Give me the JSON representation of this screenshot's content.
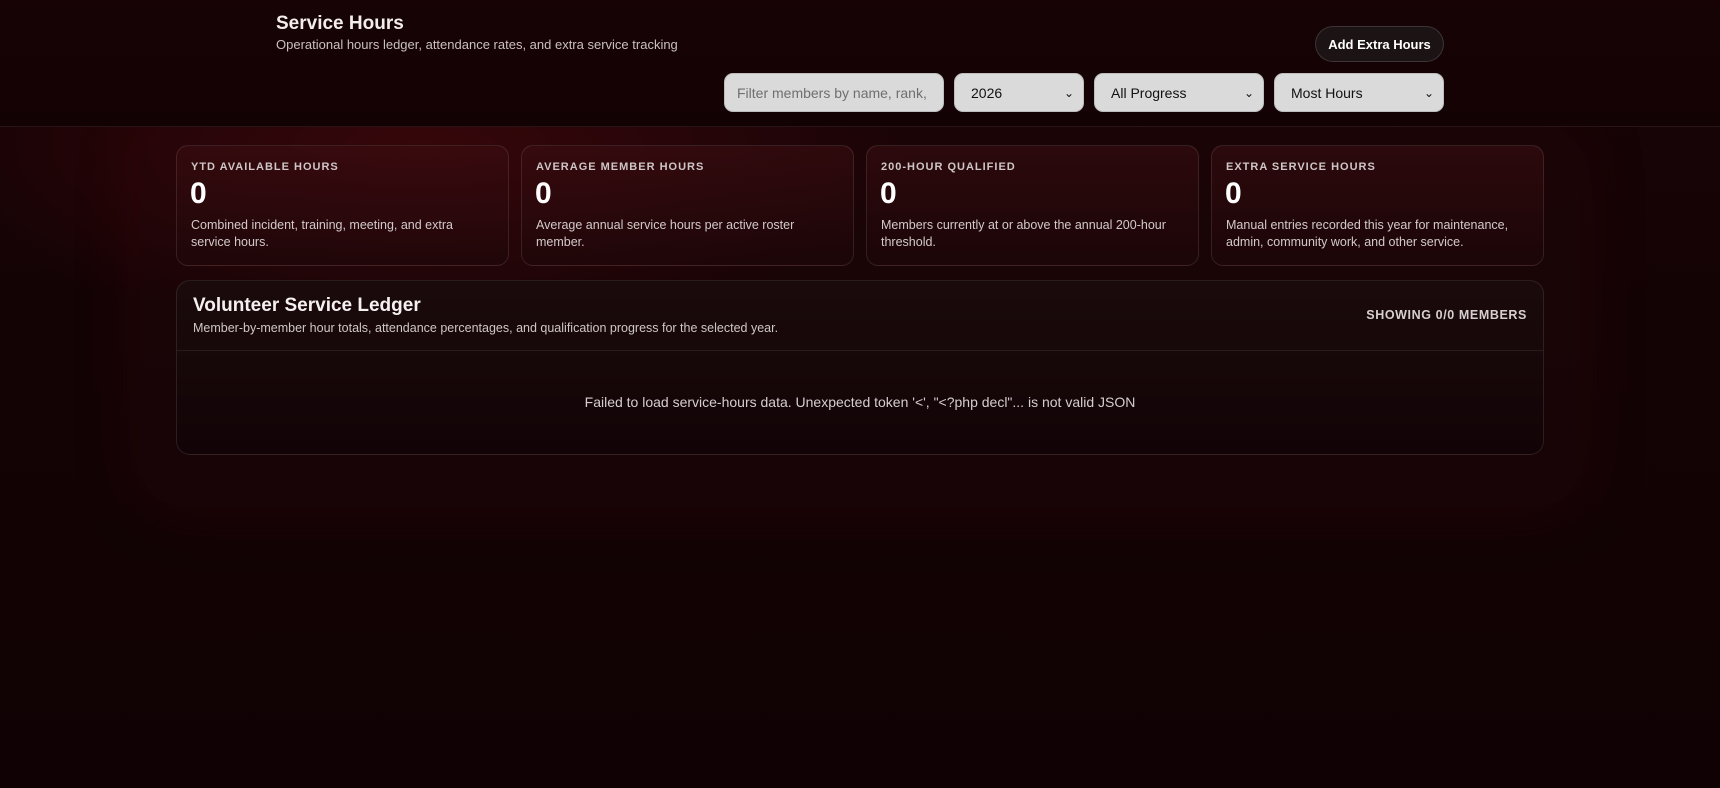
{
  "header": {
    "title": "Service Hours",
    "subtitle": "Operational hours ledger, attendance rates, and extra service tracking",
    "add_button": "Add Extra Hours"
  },
  "filters": {
    "search_placeholder": "Filter members by name, rank, or",
    "year": "2026",
    "progress": "All Progress",
    "sort": "Most Hours"
  },
  "stats": [
    {
      "label": "YTD AVAILABLE HOURS",
      "value": "0",
      "description": "Combined incident, training, meeting, and extra service hours."
    },
    {
      "label": "AVERAGE MEMBER HOURS",
      "value": "0",
      "description": "Average annual service hours per active roster member."
    },
    {
      "label": "200-HOUR QUALIFIED",
      "value": "0",
      "description": "Members currently at or above the annual 200-hour threshold."
    },
    {
      "label": "EXTRA SERVICE HOURS",
      "value": "0",
      "description": "Manual entries recorded this year for maintenance, admin, community work, and other service."
    }
  ],
  "ledger": {
    "title": "Volunteer Service Ledger",
    "subtitle": "Member-by-member hour totals, attendance percentages, and qualification progress for the selected year.",
    "count": "SHOWING 0/0 MEMBERS",
    "error": "Failed to load service-hours data. Unexpected token '<', \"<?php decl\"... is not valid JSON"
  },
  "colors": {
    "background": "#140305",
    "accent": "#5a080e",
    "card_border": "#3a2326"
  },
  "icons": {
    "select_chevron": "chevron-down-icon"
  }
}
